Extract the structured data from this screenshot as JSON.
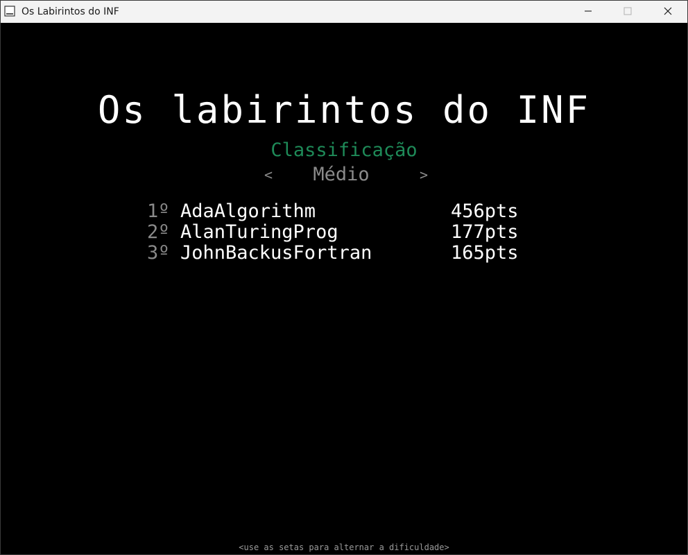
{
  "window": {
    "title": "Os Labirintos do INF",
    "icon": "app-window-icon",
    "controls": [
      "minimize-icon",
      "maximize-icon",
      "close-icon"
    ]
  },
  "game": {
    "title": "Os labirintos do INF",
    "subtitle": "Classificação",
    "difficulty": {
      "label": "Médio",
      "prev_arrow": "<",
      "next_arrow": ">"
    },
    "leaderboard": [
      {
        "rank": "1º",
        "name": "AdaAlgorithm",
        "score": "456pts"
      },
      {
        "rank": "2º",
        "name": "AlanTuringProg",
        "score": "177pts"
      },
      {
        "rank": "3º",
        "name": "JohnBackusFortran",
        "score": "165pts"
      }
    ],
    "hint": "<use as setas para alternar a dificuldade>"
  },
  "colors": {
    "background": "#000000",
    "title": "#ffffff",
    "subtitle": "#1e8a58",
    "muted": "#8a8a8a",
    "titlebar": "#f3f3f3"
  }
}
